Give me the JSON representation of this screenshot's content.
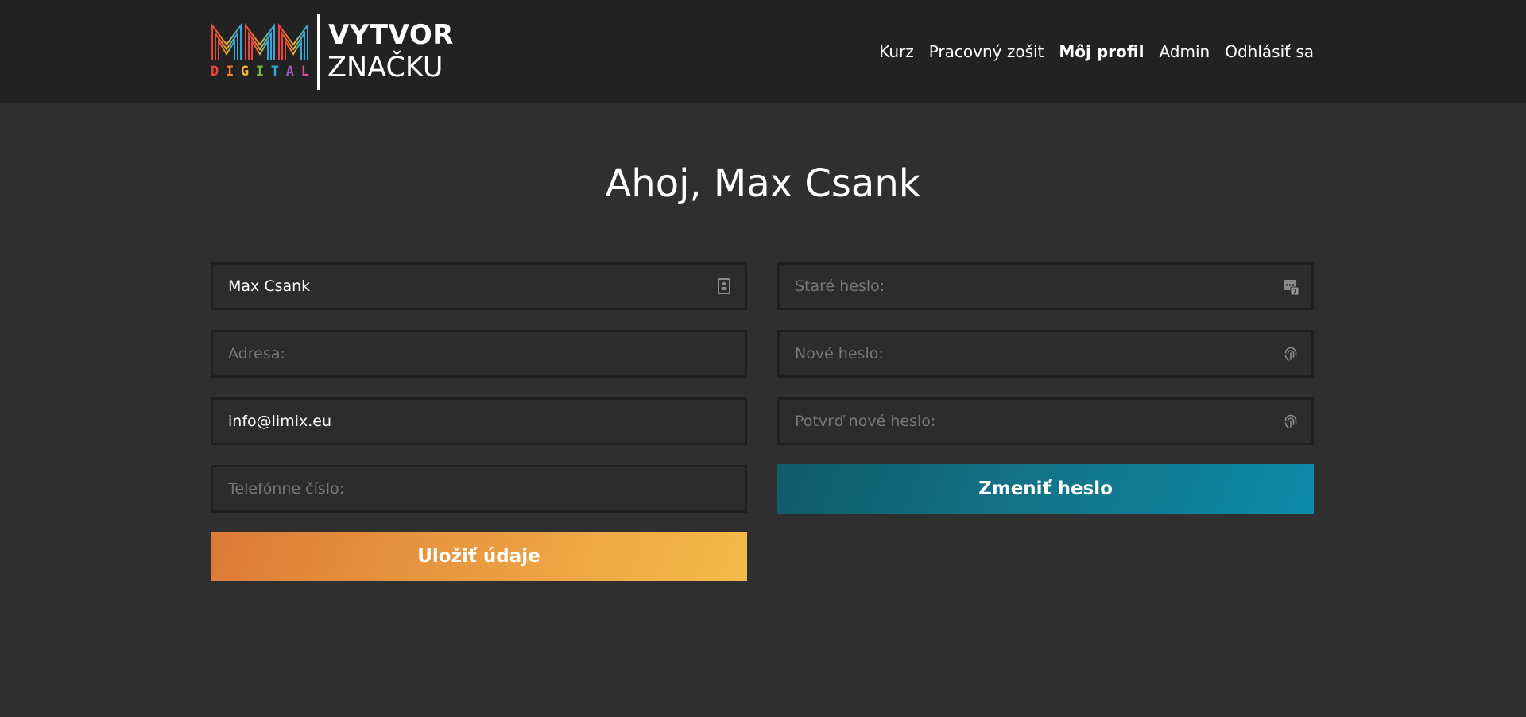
{
  "header": {
    "logo": {
      "mark_letters": "MMM",
      "subtitle_letters": [
        "D",
        "I",
        "G",
        "I",
        "T",
        "A",
        "L"
      ],
      "subtitle_colors": [
        "#e8433d",
        "#ef7d2b",
        "#f4b63c",
        "#6fbd4b",
        "#33a6d6",
        "#9b5bc4",
        "#d84a9c"
      ],
      "word1": "VYTVOR",
      "word2": "ZNAČKU"
    },
    "nav": [
      {
        "label": "Kurz",
        "active": false
      },
      {
        "label": "Pracovný zošit",
        "active": false
      },
      {
        "label": "Môj profil",
        "active": true
      },
      {
        "label": "Admin",
        "active": false
      },
      {
        "label": "Odhlásiť sa",
        "active": false
      }
    ]
  },
  "main": {
    "greeting": "Ahoj, Max Csank",
    "profile_form": {
      "name": {
        "value": "Max Csank",
        "placeholder": "",
        "icon": "contact-card-icon"
      },
      "address": {
        "value": "",
        "placeholder": "Adresa:"
      },
      "email": {
        "value": "info@limix.eu",
        "placeholder": ""
      },
      "phone": {
        "value": "",
        "placeholder": "Telefónne číslo:"
      },
      "save_label": "Uložiť údaje"
    },
    "password_form": {
      "old_password": {
        "value": "",
        "placeholder": "Staré heslo:",
        "icon": "password-keypad-icon"
      },
      "new_password": {
        "value": "",
        "placeholder": "Nové heslo:",
        "icon": "fingerprint-icon"
      },
      "confirm_password": {
        "value": "",
        "placeholder": "Potvrď nové heslo:",
        "icon": "fingerprint-icon"
      },
      "change_label": "Zmeniť heslo"
    }
  },
  "colors": {
    "header_bg": "#222222",
    "page_bg": "#2f2f2f",
    "save_gradient": [
      "#dc7a37",
      "#f5bb48"
    ],
    "change_gradient": [
      "#0f5b6a",
      "#0c8ba8"
    ]
  }
}
